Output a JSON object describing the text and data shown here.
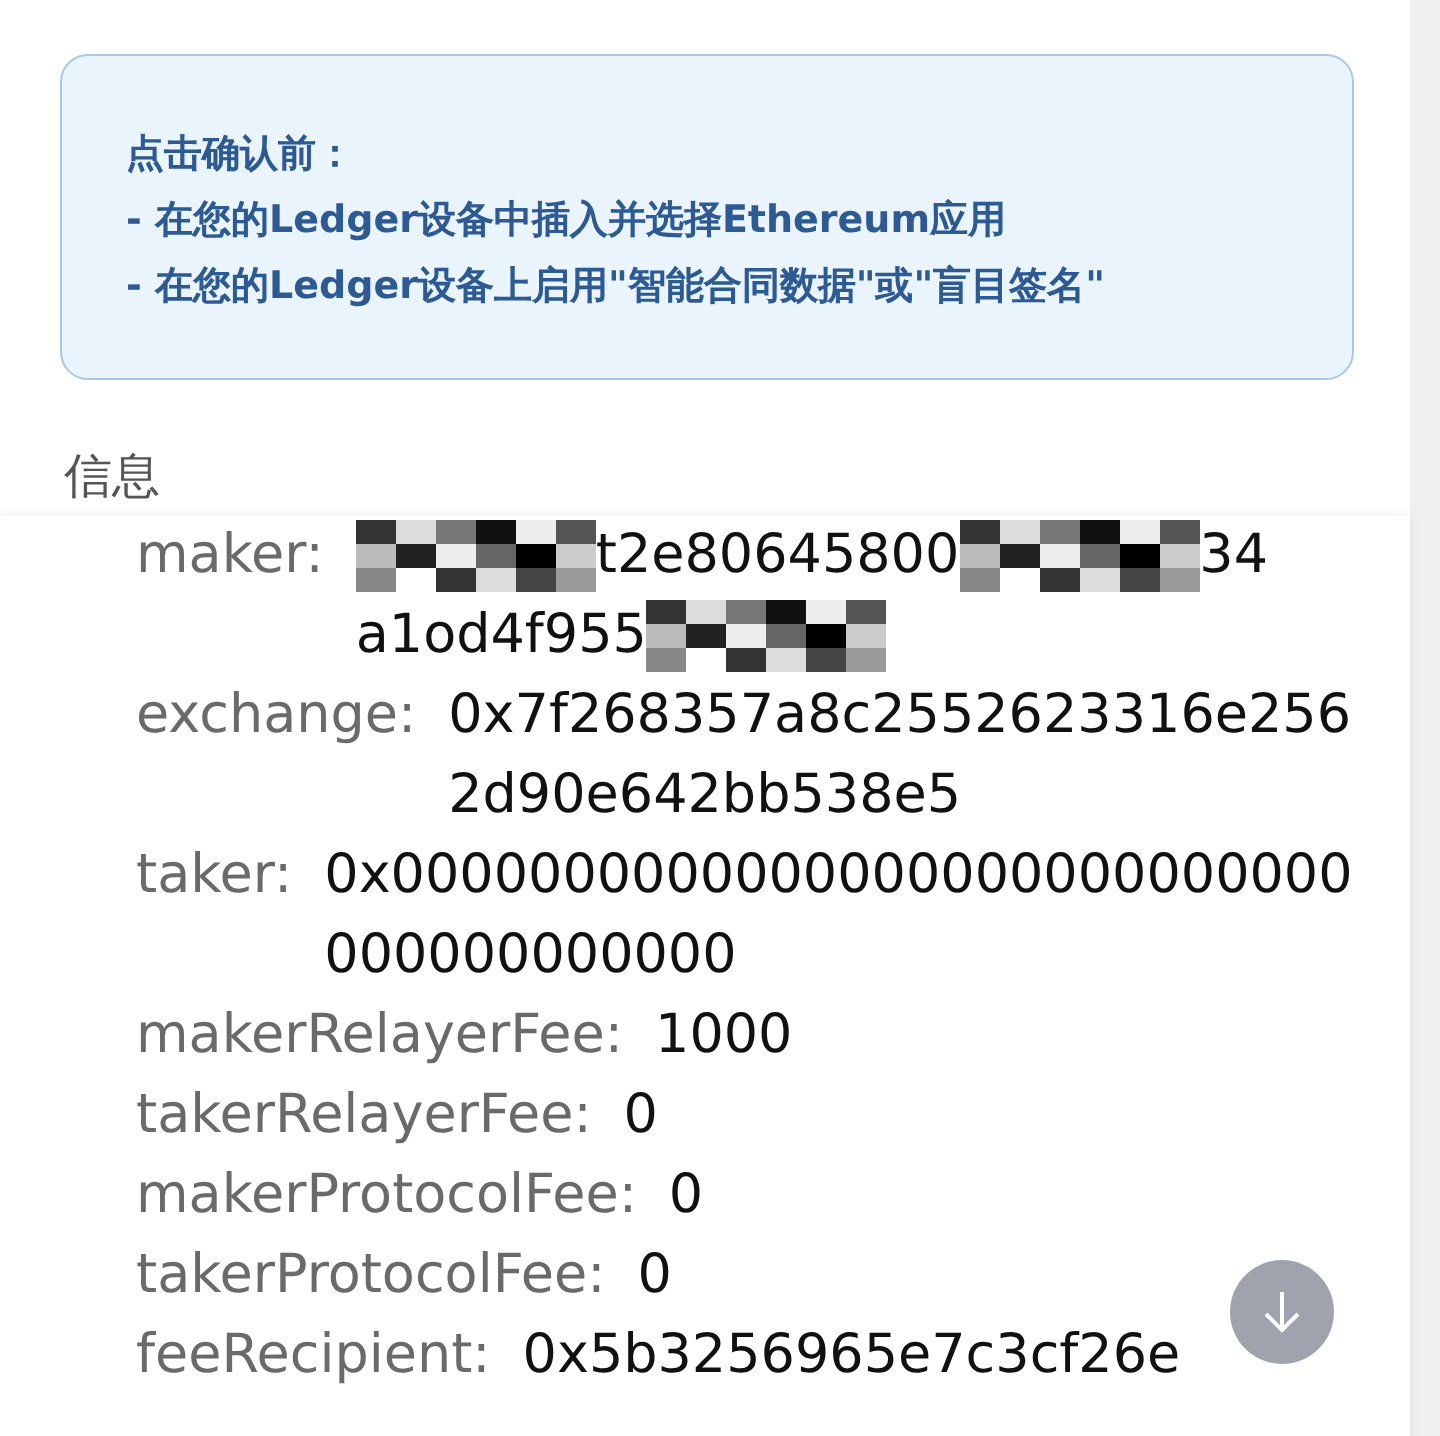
{
  "notice": {
    "lines": [
      "点击确认前：",
      "- 在您的Ledger设备中插入并选择Ethereum应用",
      "- 在您的Ledger设备上启用\"智能合同数据\"或\"盲目签名\""
    ]
  },
  "section_title": "信息",
  "fields": [
    {
      "key": "maker:",
      "kind": "redacted",
      "lines": [
        [
          {
            "kind": "mosaic"
          },
          {
            "kind": "text",
            "text": "t2e80645800"
          },
          {
            "kind": "mosaic"
          },
          {
            "kind": "text",
            "text": "34"
          }
        ],
        [
          {
            "kind": "text",
            "text": "a1od4f955"
          },
          {
            "kind": "mosaic"
          }
        ]
      ]
    },
    {
      "key": "exchange:",
      "kind": "plain",
      "value": "0x7f268357a8c2552623316e2562d90e642bb538e5"
    },
    {
      "key": "taker:",
      "kind": "plain",
      "value": "0x0000000000000000000000000000000000000000"
    },
    {
      "key": "makerRelayerFee:",
      "kind": "plain",
      "value": "1000"
    },
    {
      "key": "takerRelayerFee:",
      "kind": "plain",
      "value": "0"
    },
    {
      "key": "makerProtocolFee:",
      "kind": "plain",
      "value": "0"
    },
    {
      "key": "takerProtocolFee:",
      "kind": "plain",
      "value": "0"
    },
    {
      "key": "feeRecipient:",
      "kind": "plain",
      "value": "0x5b3256965e7c3cf26e"
    }
  ]
}
